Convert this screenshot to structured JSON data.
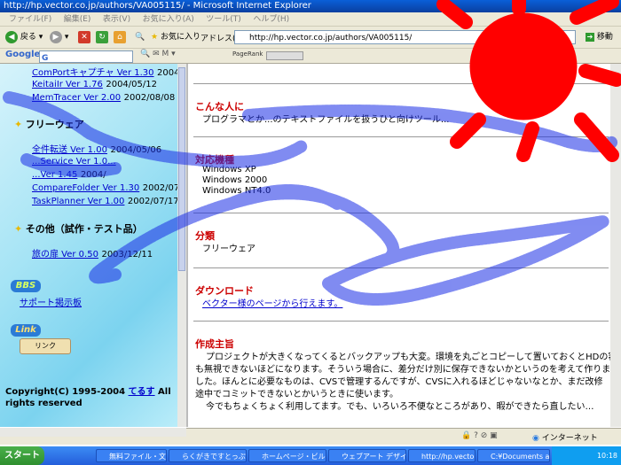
{
  "window": {
    "title": "http://hp.vector.co.jp/authors/VA005115/ - Microsoft Internet Explorer"
  },
  "menu": [
    "ファイル(F)",
    "編集(E)",
    "表示(V)",
    "お気に入り(A)",
    "ツール(T)",
    "ヘルプ(H)"
  ],
  "toolbar": {
    "back_label": "戻る",
    "favorites_label": "お気に入り",
    "address_label": "アドレス(D)",
    "address_value": "http://hp.vector.co.jp/authors/VA005115/",
    "go_label": "移動"
  },
  "googlebar": {
    "logo": "Google",
    "search_prefix": "G",
    "pagerank_label": "PageRank"
  },
  "left": {
    "top_items": [
      {
        "name": "ComPortキャプチャ Ver 1.30",
        "date": "2004/"
      },
      {
        "name": "KeitaiIr Ver 1.76",
        "date": "2004/05/12"
      },
      {
        "name": "MemTracer Ver 2.00",
        "date": "2002/08/08"
      }
    ],
    "freeware_title": "フリーウェア",
    "freeware_items": [
      {
        "name": "全件転送 Ver 1.00",
        "date": "2004/05/06"
      },
      {
        "name": "...Service Ver 1.0...",
        "date": ""
      },
      {
        "name": "...Ver 1.45",
        "date": "2004/"
      },
      {
        "name": "CompareFolder Ver 1.30",
        "date": "2002/07/"
      },
      {
        "name": "TaskPlanner Ver 1.00",
        "date": "2002/07/17"
      }
    ],
    "other_title": "その他（試作・テスト品）",
    "other_items": [
      {
        "name": "旅の扉 Ver 0.50",
        "date": "2003/12/11"
      }
    ],
    "bbs_badge": "BBS",
    "bbs_link": "サポート掲示板",
    "link_badge": "Link",
    "link_button": "リンク",
    "copyright": "Copyright(C) 1995-2004",
    "author_link": "てるす",
    "rights": "All rights reserved"
  },
  "right": {
    "sections": [
      {
        "heading": "こんな人に",
        "lines": [
          "プログラマとか...のテキストファイルを扱うひと向けツール..."
        ]
      },
      {
        "heading": "対応機種",
        "lines": [
          "Windows XP",
          "Windows 2000",
          "Windows NT4.0"
        ]
      },
      {
        "heading": "分類",
        "lines": [
          "フリーウェア"
        ]
      },
      {
        "heading": "ダウンロード",
        "link": "ベクター様のページから行えます。"
      },
      {
        "heading": "作成主旨",
        "lines": [
          "プロジェクトが大きくなってくるとバックアップも大変。環境を丸ごとコピーして置いておくとHDの容量",
          "も無視できないほどになります。そういう場合に、差分だけ別に保存できないかというのを考えて作りま",
          "した。ほんとに必要なものは、CVSで管理するんですが、CVSに入れるほどじゃないなとか、まだ改修",
          "途中でコミットできないとかいうときに使います。",
          "今でもちょくちょく利用してます。でも、いろいろ不便なところがあり、暇ができたら直したい…"
        ]
      }
    ]
  },
  "status": {
    "zone": "インターネット"
  },
  "taskbar": {
    "start_label": "スタート",
    "tasks": [
      "無料ファイル・文...",
      "らくがきですとっぷ...",
      "ホームページ・ビル...",
      "ウェブアート デザイ...",
      "http://hp.vector.co...",
      "C:¥Documents a..."
    ],
    "clock": "10:18"
  },
  "colors": {
    "heading": "#cc0000",
    "link": "#0000cc",
    "sun": "#ff0000",
    "scribble": "#1a2ee6"
  }
}
